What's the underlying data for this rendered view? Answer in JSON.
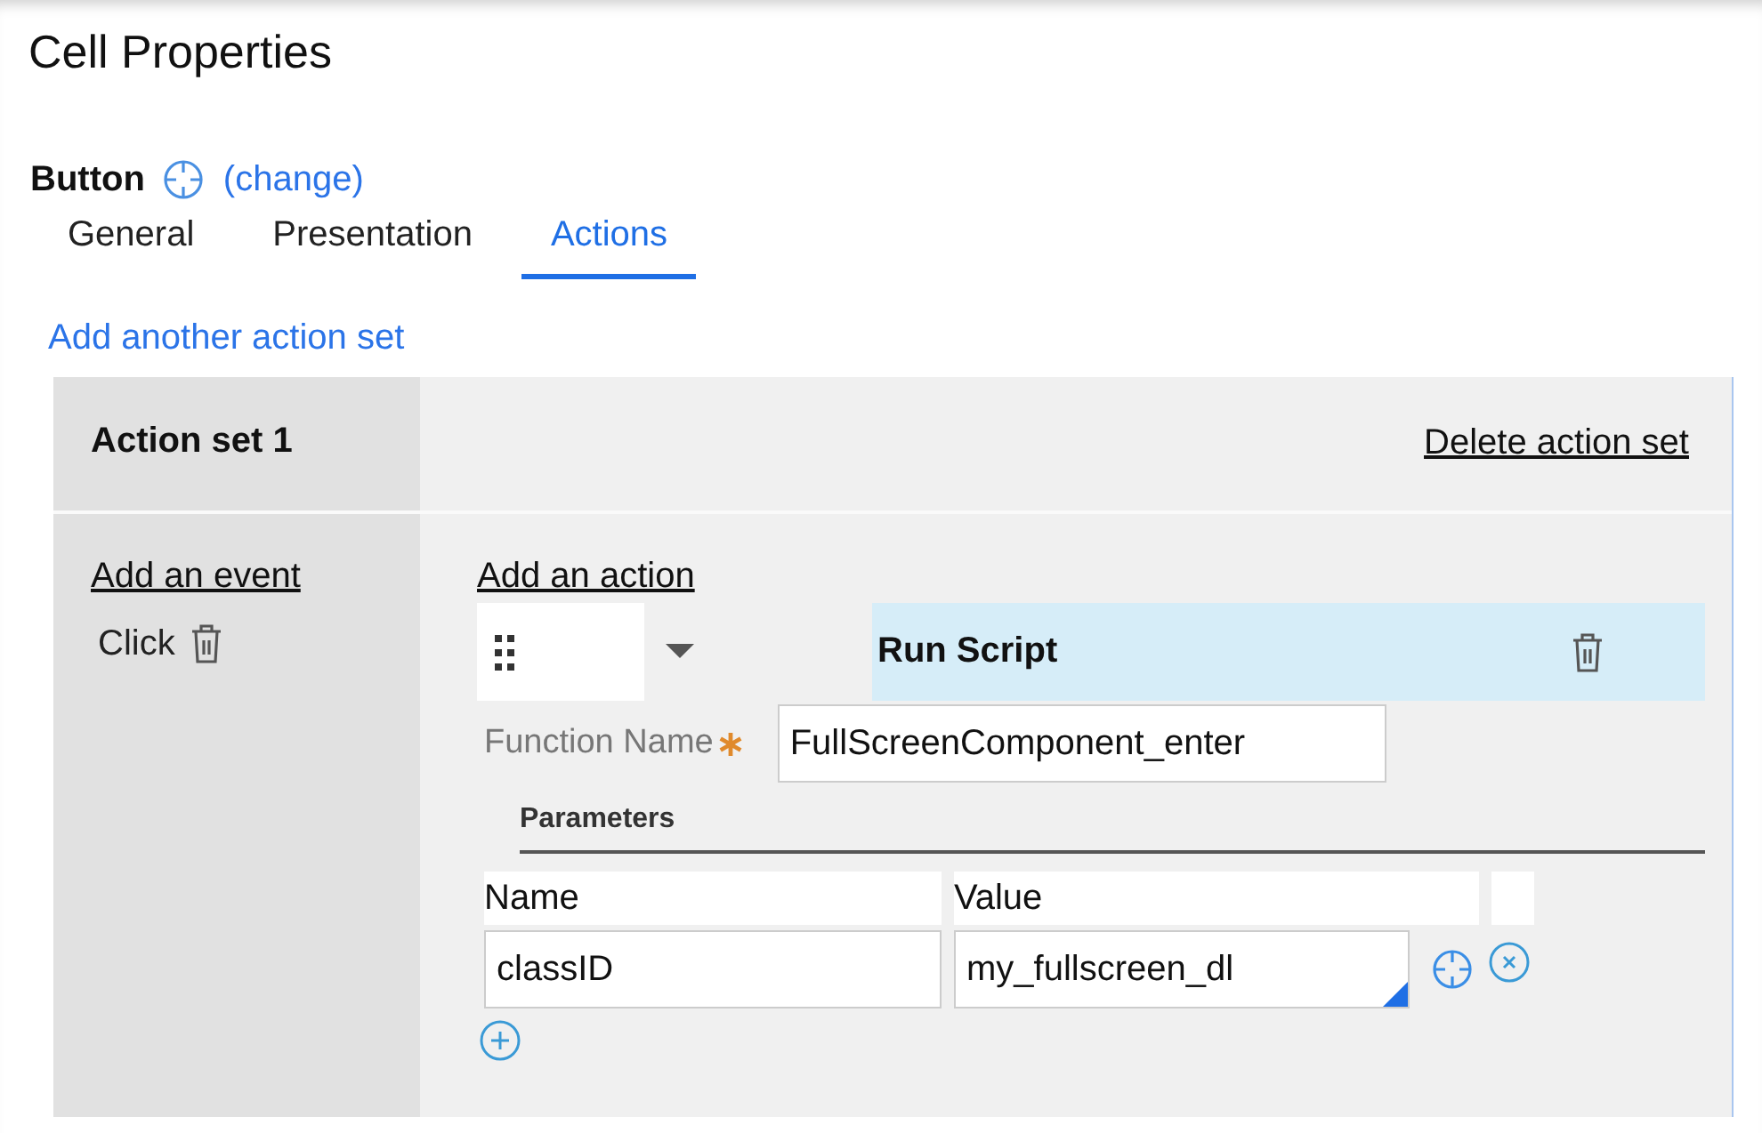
{
  "panel": {
    "title": "Cell Properties"
  },
  "control": {
    "type": "Button",
    "change_link": "(change)"
  },
  "tabs": [
    {
      "label": "General",
      "selected": false
    },
    {
      "label": "Presentation",
      "selected": false
    },
    {
      "label": "Actions",
      "selected": true
    }
  ],
  "add_action_set": "Add another action set",
  "action_sets": [
    {
      "title": "Action set 1",
      "delete": "Delete action set",
      "add_event": "Add an event",
      "events": [
        {
          "name": "Click"
        }
      ],
      "add_action": "Add an action",
      "actions": [
        {
          "name": "Run Script",
          "function_name_label": "Function Name",
          "required": true,
          "function_name": "FullScreenComponent_enter",
          "parameters_title": "Parameters",
          "columns": [
            "Name",
            "Value"
          ],
          "parameters": [
            {
              "name": "classID",
              "value": "my_fullscreen_dl"
            }
          ]
        }
      ]
    }
  ]
}
